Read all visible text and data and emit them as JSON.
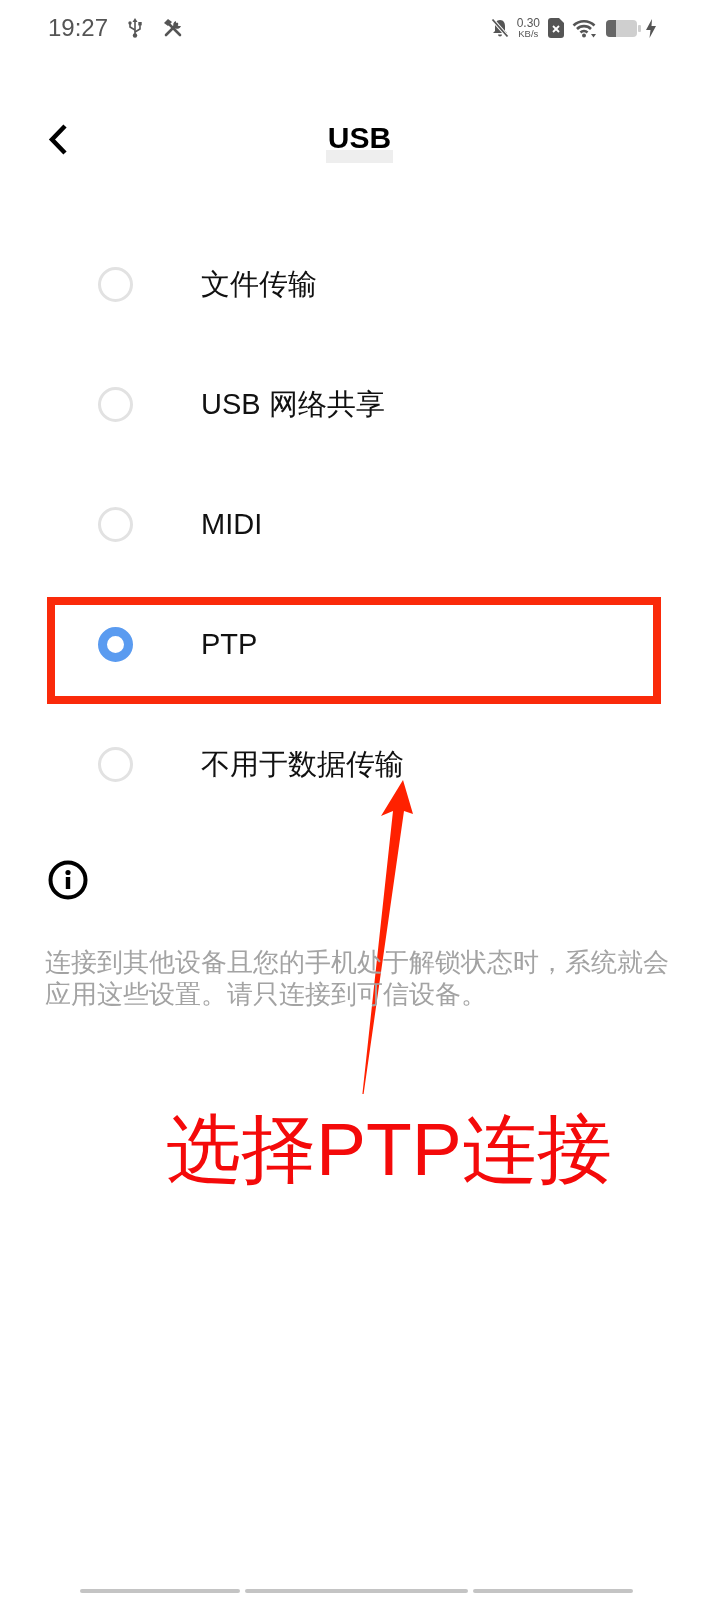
{
  "status_bar": {
    "time": "19:27",
    "net_speed": "0.30",
    "net_unit": "KB/s"
  },
  "header": {
    "title": "USB"
  },
  "options": [
    {
      "label": "文件传输",
      "selected": false,
      "highlighted": false
    },
    {
      "label": "USB 网络共享",
      "selected": false,
      "highlighted": false
    },
    {
      "label": "MIDI",
      "selected": false,
      "highlighted": false
    },
    {
      "label": "PTP",
      "selected": true,
      "highlighted": true
    },
    {
      "label": "不用于数据传输",
      "selected": false,
      "highlighted": false
    }
  ],
  "info": {
    "text": "连接到其他设备且您的手机处于解锁状态时，系统就会应用这些设置。请只连接到可信设备。"
  },
  "annotation": {
    "text": "选择PTP连接"
  }
}
